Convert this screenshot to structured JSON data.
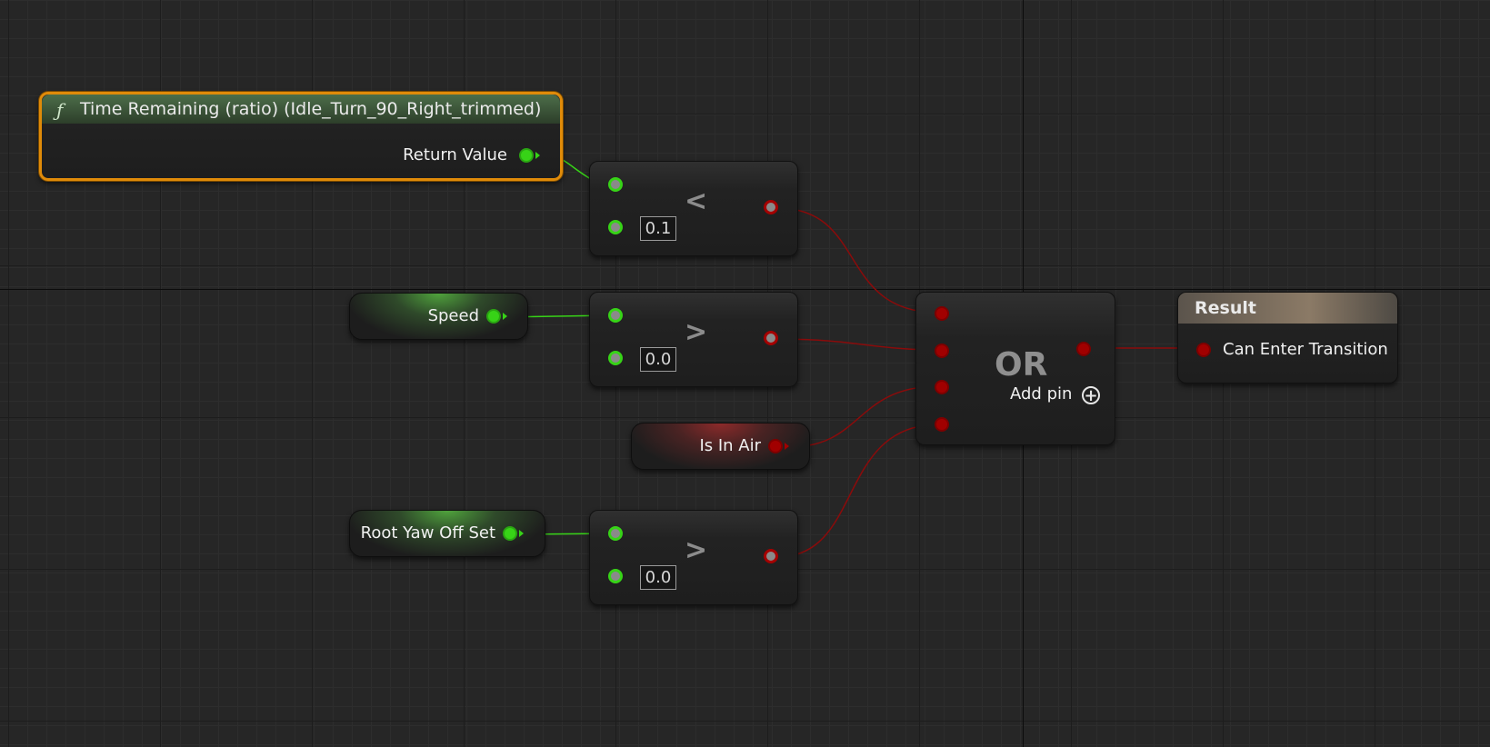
{
  "graph": {
    "function_node": {
      "icon": "function-icon",
      "title": "Time Remaining (ratio) (Idle_Turn_90_Right_trimmed)",
      "output_label": "Return Value"
    },
    "less_node": {
      "operator": "<",
      "default_value": "0.1"
    },
    "greater_speed_node": {
      "operator": ">",
      "default_value": "0.0"
    },
    "greater_yaw_node": {
      "operator": ">",
      "default_value": "0.0"
    },
    "speed_variable": {
      "label": "Speed"
    },
    "is_in_air_variable": {
      "label": "Is In Air"
    },
    "root_yaw_variable": {
      "label": "Root Yaw Off Set"
    },
    "or_node": {
      "label": "OR",
      "add_pin_label": "Add pin",
      "add_pin_icon": "plus-circle-icon"
    },
    "result_node": {
      "title": "Result",
      "input_label": "Can Enter Transition"
    }
  },
  "colors": {
    "float_pin": "#37d317",
    "bool_pin": "#a10000",
    "selection_outline": "#e08b09",
    "float_wire": "#37d317",
    "bool_wire": "#8a0b0b"
  }
}
